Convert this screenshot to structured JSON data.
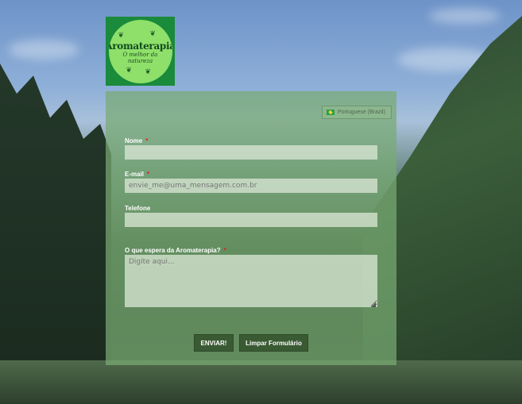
{
  "logo": {
    "title": "Aromaterapia",
    "subtitle_line1": "O melhor da",
    "subtitle_line2": "natureza"
  },
  "language": {
    "label": "Portuguese (Brazil)",
    "flag_icon": "brazil-flag-icon"
  },
  "form": {
    "fields": {
      "nome": {
        "label": "Nome",
        "required_mark": "*",
        "value": "",
        "placeholder": ""
      },
      "email": {
        "label": "E-mail",
        "required_mark": "*",
        "value": "",
        "placeholder": "envie_me@uma_mensagem.com.br"
      },
      "telefone": {
        "label": "Telefone",
        "value": "",
        "placeholder": ""
      },
      "expectativa": {
        "label": "O que espera da Aromaterapia?",
        "required_mark": "*",
        "value": "",
        "placeholder": "Digite aqui..."
      }
    },
    "buttons": {
      "submit": "ENVIAR!",
      "reset": "Limpar Formulário"
    }
  },
  "colors": {
    "panel_bg": "#78aa73",
    "button_bg": "#3a5a34",
    "logo_bg": "#1a8a3b",
    "required": "#e02020"
  }
}
